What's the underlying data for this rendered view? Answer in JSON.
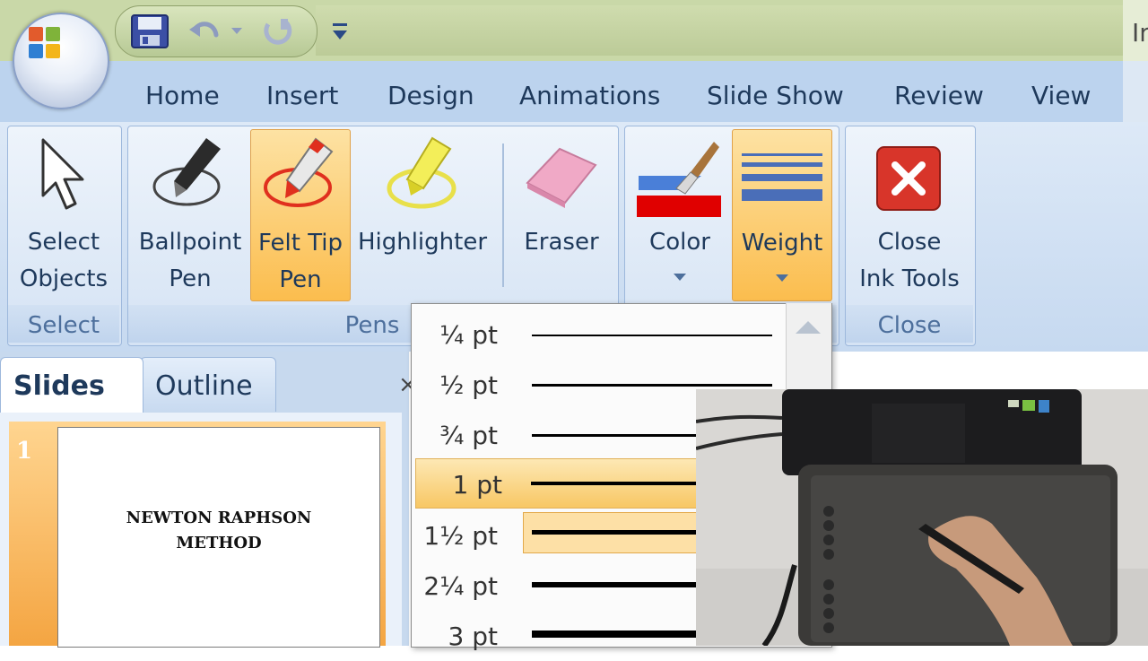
{
  "window": {
    "title_partial": "In"
  },
  "tabs": [
    "Home",
    "Insert",
    "Design",
    "Animations",
    "Slide Show",
    "Review",
    "View"
  ],
  "ribbon": {
    "groups": {
      "select": "Select",
      "pens": "Pens",
      "close": "Close"
    },
    "buttons": {
      "select_objects": [
        "Select",
        "Objects"
      ],
      "ballpoint_pen": [
        "Ballpoint",
        "Pen"
      ],
      "felt_tip_pen": [
        "Felt Tip",
        "Pen"
      ],
      "highlighter": "Highlighter",
      "eraser": "Eraser",
      "color": "Color",
      "weight": "Weight",
      "close_ink_tools": [
        "Close",
        "Ink Tools"
      ]
    }
  },
  "panel_tabs": [
    "Slides",
    "Outline"
  ],
  "slides": [
    {
      "number": "1",
      "title_lines": [
        "NEWTON RAPHSON",
        "METHOD"
      ]
    }
  ],
  "weight_options": [
    {
      "label": "¼ pt",
      "thickness": 0.25
    },
    {
      "label": "½ pt",
      "thickness": 0.5
    },
    {
      "label": "¾ pt",
      "thickness": 0.75
    },
    {
      "label": "1 pt",
      "thickness": 1,
      "selected": true
    },
    {
      "label": "1½ pt",
      "thickness": 1.5,
      "hovered": true
    },
    {
      "label": "2¼ pt",
      "thickness": 2.25
    },
    {
      "label": "3 pt",
      "thickness": 3
    }
  ],
  "colors": {
    "ink_color_swatch": "#e00000",
    "accent_selected": "#fbbd4e",
    "tab_text": "#1e395b"
  }
}
